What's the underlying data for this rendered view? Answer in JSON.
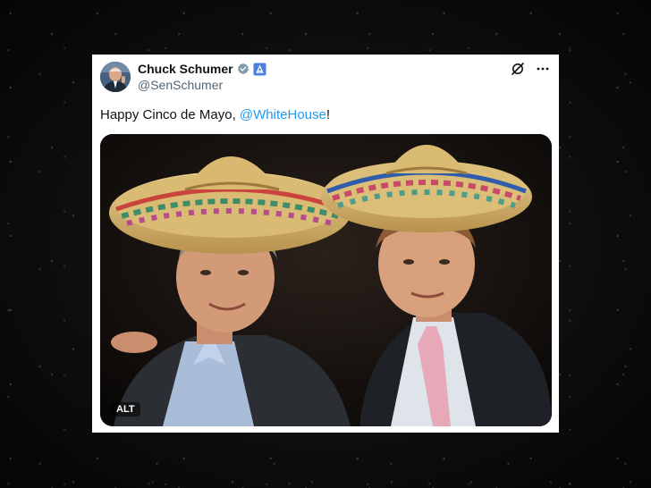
{
  "post": {
    "author_name": "Chuck Schumer",
    "author_handle": "@SenSchumer",
    "text_before": "Happy Cinco de Mayo, ",
    "mention": "@WhiteHouse",
    "text_after": "!",
    "media_alt_label": "ALT"
  },
  "icons": {
    "verified": "verified-badge-icon",
    "affiliate": "government-affiliate-icon",
    "grok": "grok-icon",
    "more": "more-options-icon"
  },
  "colors": {
    "link": "#1d9bf0",
    "verified": "#829aab",
    "affiliate": "#4d7fe0"
  }
}
